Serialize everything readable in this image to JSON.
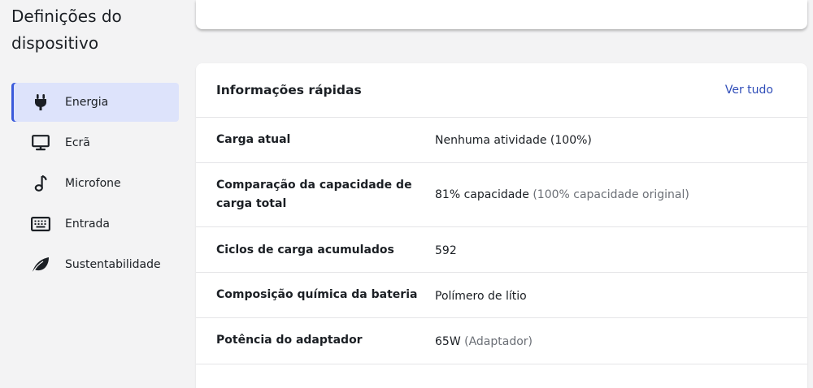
{
  "sidebar": {
    "title": "Definições do dispositivo",
    "items": [
      {
        "label": "Energia",
        "icon": "plug-icon",
        "active": true
      },
      {
        "label": "Ecrã",
        "icon": "monitor-icon",
        "active": false
      },
      {
        "label": "Microfone",
        "icon": "music-note-icon",
        "active": false
      },
      {
        "label": "Entrada",
        "icon": "keyboard-icon",
        "active": false
      },
      {
        "label": "Sustentabilidade",
        "icon": "leaf-icon",
        "active": false
      }
    ]
  },
  "quick_info": {
    "title": "Informações rápidas",
    "see_all": "Ver tudo",
    "rows": [
      {
        "label": "Carga atual",
        "value": "Nenhuma atividade (100%)",
        "note": ""
      },
      {
        "label": "Comparação da capacidade de carga total",
        "value": "81% capacidade",
        "note": "(100% capacidade original)"
      },
      {
        "label": "Ciclos de carga acumulados",
        "value": "592",
        "note": ""
      },
      {
        "label": "Composição química da bateria",
        "value": "Polímero de lítio",
        "note": ""
      },
      {
        "label": "Potência do adaptador",
        "value": "65W",
        "note": "(Adaptador)"
      }
    ]
  },
  "colors": {
    "accent": "#3b5bdb",
    "active_bg": "#dde3fb",
    "link": "#2f4db8",
    "muted": "#6b6f76",
    "background": "#f3f3f4"
  }
}
